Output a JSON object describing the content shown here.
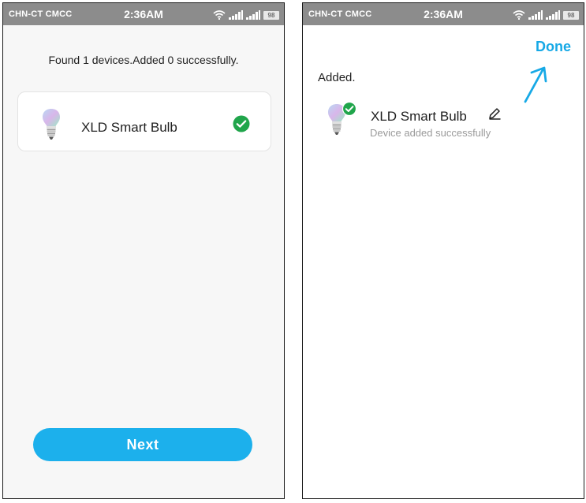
{
  "statusbar": {
    "carrier": "CHN-CT  CMCC",
    "time": "2:36AM",
    "battery": "98",
    "icons": [
      "wifi-icon",
      "signal-icon",
      "signal-icon",
      "battery-icon"
    ]
  },
  "screen_found": {
    "message": "Found 1 devices.Added 0 successfully.",
    "device": {
      "name": "XLD Smart Bulb",
      "icon": "bulb-icon",
      "status_icon": "check-circle-icon"
    },
    "next_label": "Next"
  },
  "screen_added": {
    "done_label": "Done",
    "heading": "Added.",
    "device": {
      "name": "XLD Smart Bulb",
      "status": "Device added successfully",
      "icon": "bulb-icon",
      "edit_icon": "pencil-icon"
    }
  },
  "colors": {
    "accent": "#1cb0ec",
    "success": "#20a54b",
    "statusbar": "#8c8c8c"
  }
}
